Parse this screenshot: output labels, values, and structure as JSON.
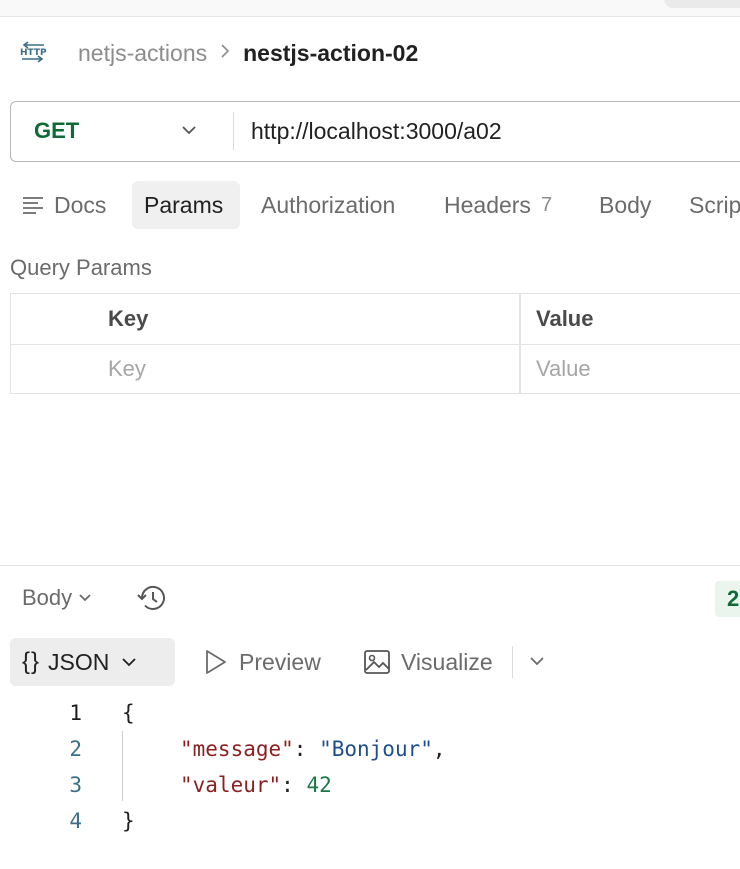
{
  "colors": {
    "method": "#0f6b36",
    "accent_bg": "#f0f0f0",
    "json_key": "#8a1f1f",
    "json_string": "#1f4f8a",
    "json_number": "#1c7a4a"
  },
  "breadcrumb": {
    "icon": "http-icon",
    "parent": "netjs-actions",
    "current": "nestjs-action-02"
  },
  "request": {
    "method": "GET",
    "url": "http://localhost:3000/a02"
  },
  "tabs": [
    {
      "label": "Docs",
      "icon": "docs-icon"
    },
    {
      "label": "Params",
      "active": true
    },
    {
      "label": "Authorization"
    },
    {
      "label": "Headers",
      "count": "7"
    },
    {
      "label": "Body"
    },
    {
      "label": "Scripts"
    }
  ],
  "query_params": {
    "title": "Query Params",
    "columns": [
      "Key",
      "Value"
    ],
    "placeholders": {
      "key": "Key",
      "value": "Value"
    }
  },
  "response": {
    "body_label": "Body",
    "status": "2",
    "formats": {
      "active": "JSON",
      "preview": "Preview",
      "visualize": "Visualize"
    },
    "lines": [
      {
        "n": "1",
        "open": "{"
      },
      {
        "n": "2",
        "key": "\"message\"",
        "colon": ": ",
        "value": "\"Bonjour\"",
        "tail": ","
      },
      {
        "n": "3",
        "key": "\"valeur\"",
        "colon": ": ",
        "value": "42"
      },
      {
        "n": "4",
        "close": "}"
      }
    ]
  }
}
